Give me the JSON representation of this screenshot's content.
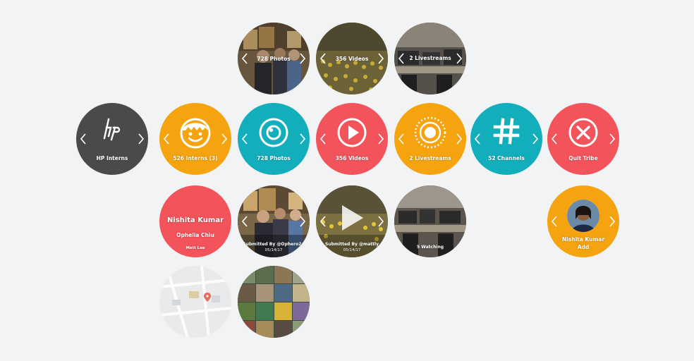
{
  "colors": {
    "dark": "#4a4a4a",
    "orange": "#f5a410",
    "teal": "#13aebc",
    "coral": "#f3535a",
    "bg": "#f2f3f5"
  },
  "top_row": [
    {
      "label": "728 Photos"
    },
    {
      "label": "356 Videos"
    },
    {
      "label": "2 Livestreams"
    }
  ],
  "middle_row": [
    {
      "label": "HP Interns",
      "icon": "hp-logo-icon"
    },
    {
      "label": "526 Interns (3)",
      "icon": "smiley-face-icon"
    },
    {
      "label": "728 Photos",
      "icon": "camera-lens-icon"
    },
    {
      "label": "356 Videos",
      "icon": "play-icon"
    },
    {
      "label": "2 Livestreams",
      "icon": "broadcast-icon"
    },
    {
      "label": "52 Channels",
      "icon": "hashtag-icon"
    },
    {
      "label": "Quit Tribe",
      "icon": "close-icon"
    }
  ],
  "profile": {
    "name": "Nishita Kumar",
    "sub": "Ophelia Chiu",
    "tag": "Matt Lee"
  },
  "photo_card": {
    "submitted": "Submitted By @Ophero24",
    "date": "05/14/17"
  },
  "video_card": {
    "submitted": "Submitted By @mattly",
    "date": "05/14/17"
  },
  "live_card": {
    "watching": "5 Watching"
  },
  "member_card": {
    "name": "Nishita Kumar",
    "action": "Add"
  }
}
